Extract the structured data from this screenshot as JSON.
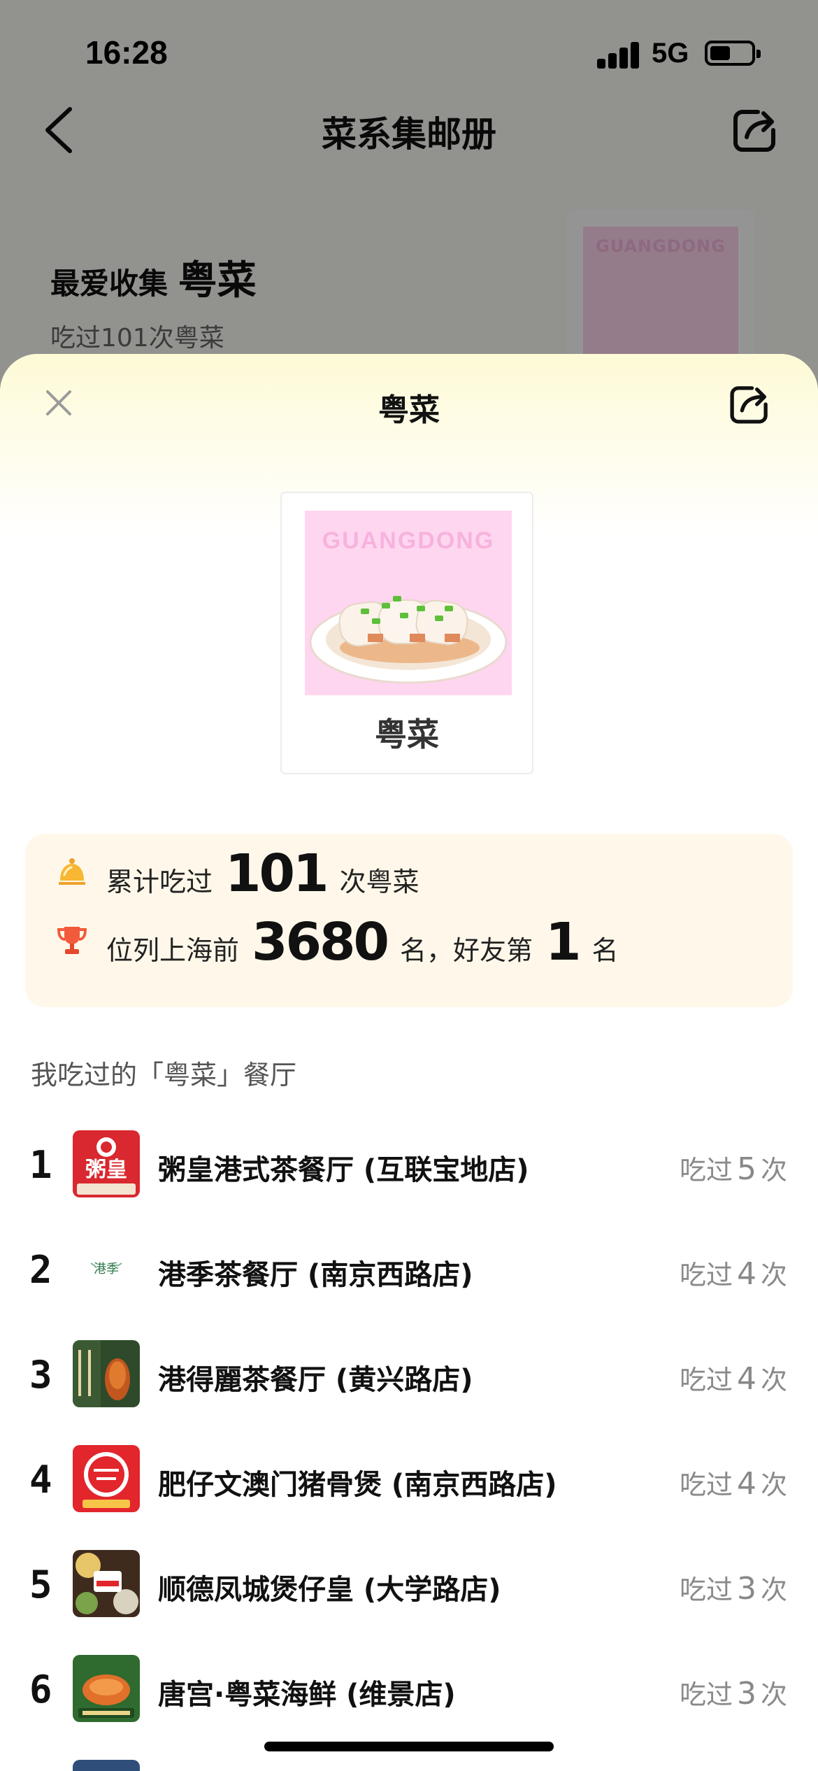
{
  "status_bar": {
    "time": "16:28",
    "network": "5G"
  },
  "background_page": {
    "title": "菜系集邮册",
    "favorite_prefix": "最爱收集",
    "favorite_cuisine": "粤菜",
    "favorite_sub": "吃过101次粤菜",
    "stamp_label": "GUANGDONG"
  },
  "sheet": {
    "title": "粤菜",
    "stamp": {
      "art_label": "GUANGDONG",
      "name": "粤菜"
    },
    "stats": {
      "line1": {
        "prefix": "累计吃过",
        "value": "101",
        "suffix": "次粤菜"
      },
      "line2": {
        "prefix": "位列上海前",
        "value": "3680",
        "middle": "名，好友第",
        "rank": "1",
        "suffix": "名"
      }
    },
    "section_title": "我吃过的「粤菜」餐厅",
    "count_prefix": "吃过",
    "count_suffix": "次",
    "restaurants": [
      {
        "rank": "1",
        "name": "粥皇港式茶餐厅 (互联宝地店)",
        "count": "5",
        "logo": "zhouhuang-logo"
      },
      {
        "rank": "2",
        "name": "港季茶餐厅 (南京西路店)",
        "count": "4",
        "logo": "gangji-logo"
      },
      {
        "rank": "3",
        "name": "港得麗茶餐厅 (黄兴路店)",
        "count": "4",
        "logo": "gangdeli-logo"
      },
      {
        "rank": "4",
        "name": "肥仔文澳门猪骨煲 (南京西路店)",
        "count": "4",
        "logo": "feizaiwen-logo"
      },
      {
        "rank": "5",
        "name": "顺德凤城煲仔皇 (大学路店)",
        "count": "3",
        "logo": "shunde-logo"
      },
      {
        "rank": "6",
        "name": "唐宫·粤菜海鲜 (维景店)",
        "count": "3",
        "logo": "tanggong-logo"
      }
    ]
  },
  "colors": {
    "stats_bg": "#fff8ea",
    "stamp_pink": "#ffd6f0",
    "sheet_glow": "#fdfad6"
  }
}
